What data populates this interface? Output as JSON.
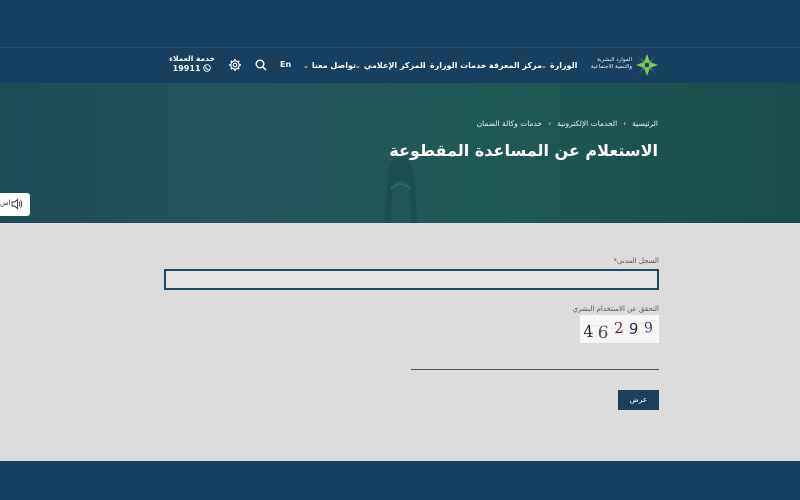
{
  "header": {
    "logo_text": "الموارد البشرية والتنمية الاجتماعية",
    "nav": [
      {
        "label": "الوزارة"
      },
      {
        "label": "مركز المعرفة"
      },
      {
        "label": "خدمات الوزارة"
      },
      {
        "label": "المركز الإعلامي"
      },
      {
        "label": "تواصل معنا"
      }
    ],
    "lang_label": "En",
    "customer_service": {
      "label": "خدمة العملاء",
      "number": "19911"
    }
  },
  "hero": {
    "breadcrumb": [
      "الرئيسية",
      "الخدمات الإلكترونية",
      "خدمات وكالة الضمان"
    ],
    "title": "الاستعلام عن المساعدة المقطوعة"
  },
  "accessibility": {
    "label": "اس"
  },
  "form": {
    "id_label": "السجل المدني",
    "required_mark": "*",
    "id_value": "",
    "captcha_label": "التحقق عن الاستخدام البشري",
    "captcha_digits": [
      "4",
      "6",
      "2",
      "9",
      "9"
    ],
    "captcha_value": "",
    "submit_label": "عرض"
  },
  "colors": {
    "navy": "#173f5f",
    "hero_teal": "#23575c",
    "button": "#1c3f5a",
    "page_bg": "#dcdcdc"
  },
  "icons": [
    "search-icon",
    "settings-icon",
    "phone-icon",
    "speaker-icon",
    "chevron-down-icon",
    "tower-icon"
  ]
}
